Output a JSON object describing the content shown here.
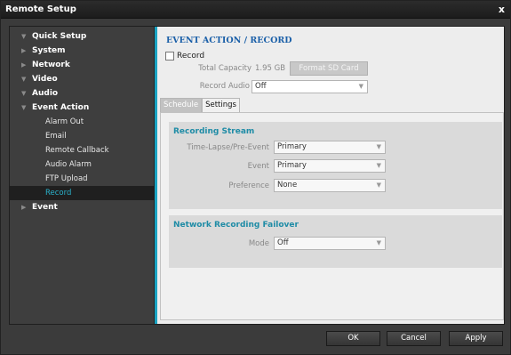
{
  "window": {
    "title": "Remote Setup",
    "close_glyph": "x"
  },
  "sidebar": {
    "items": [
      {
        "label": "Quick Setup",
        "arrow": "▼"
      },
      {
        "label": "System",
        "arrow": "▶"
      },
      {
        "label": "Network",
        "arrow": "▶"
      },
      {
        "label": "Video",
        "arrow": "▼"
      },
      {
        "label": "Audio",
        "arrow": "▼"
      },
      {
        "label": "Event Action",
        "arrow": "▼",
        "children": [
          "Alarm Out",
          "Email",
          "Remote Callback",
          "Audio Alarm",
          "FTP Upload",
          "Record"
        ]
      },
      {
        "label": "Event",
        "arrow": "▶"
      }
    ],
    "active_child": "Record"
  },
  "panel": {
    "title": "EVENT ACTION / RECORD",
    "record_label": "Record",
    "record_checked": false,
    "total_capacity_label": "Total Capacity",
    "total_capacity_value": "1.95 GB",
    "format_button": "Format SD Card",
    "record_audio_label": "Record Audio",
    "record_audio_value": "Off"
  },
  "tabs": [
    "Schedule",
    "Settings"
  ],
  "active_tab": "Settings",
  "recording_stream": {
    "title": "Recording Stream",
    "timelapse_label": "Time-Lapse/Pre-Event",
    "timelapse_value": "Primary",
    "event_label": "Event",
    "event_value": "Primary",
    "preference_label": "Preference",
    "preference_value": "None"
  },
  "network_failover": {
    "title": "Network Recording Failover",
    "mode_label": "Mode",
    "mode_value": "Off"
  },
  "footer": {
    "ok": "OK",
    "cancel": "Cancel",
    "apply": "Apply"
  },
  "colors": {
    "accent": "#1aa3c2",
    "title_blue": "#1a5fa8",
    "group_title": "#1f8ca6",
    "active_item": "#2ab2cc"
  },
  "icons": {
    "dropdown": "chevron-down-icon",
    "tree_expanded": "triangle-down-icon",
    "tree_collapsed": "triangle-right-icon"
  }
}
